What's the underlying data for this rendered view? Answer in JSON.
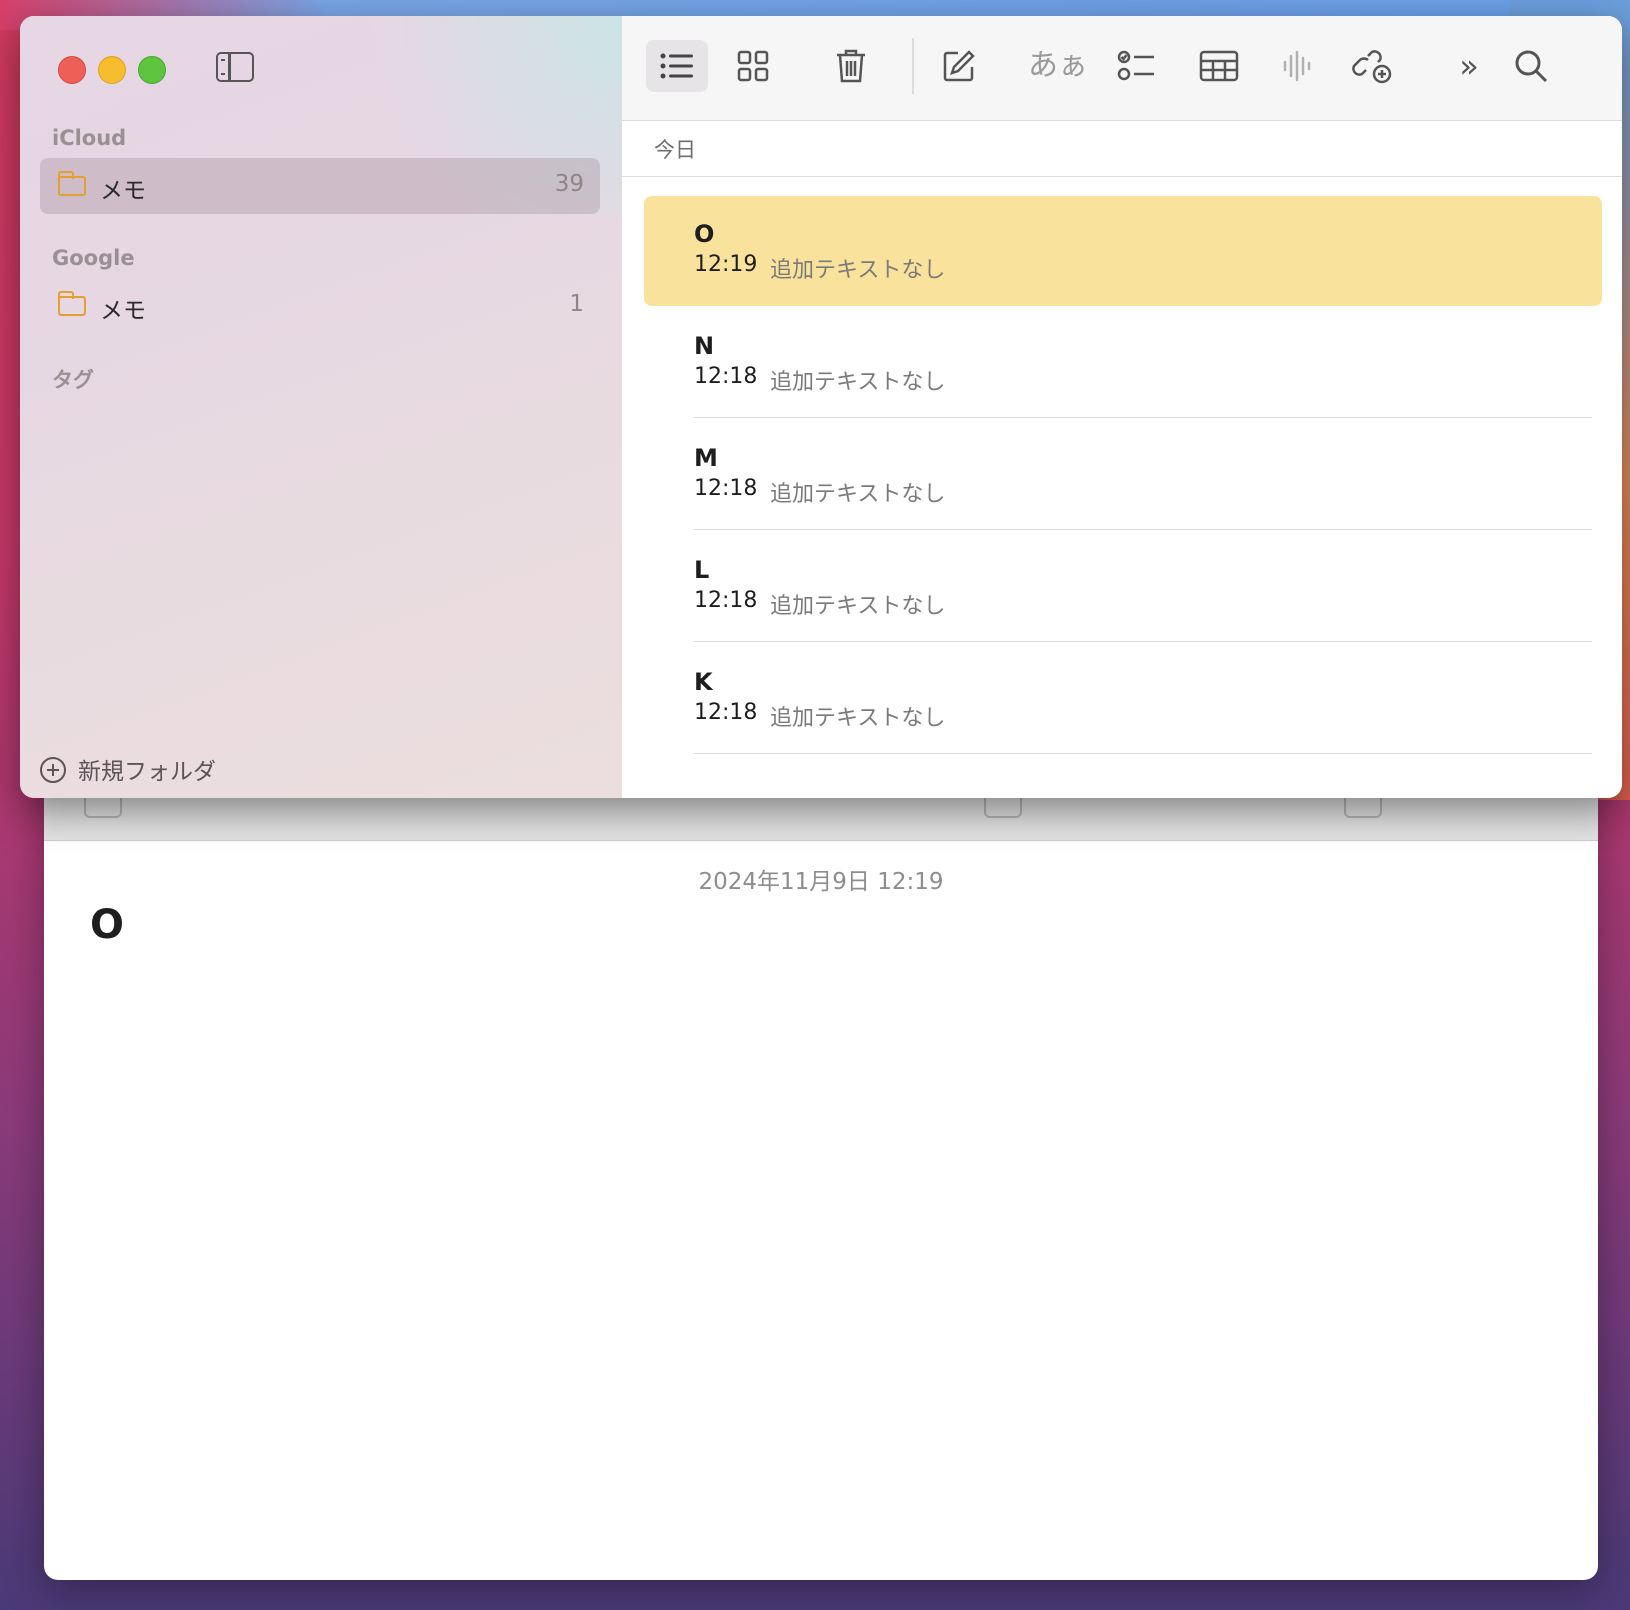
{
  "window": {
    "sidebar": {
      "sections": [
        {
          "label": "iCloud",
          "folders": [
            {
              "name": "メモ",
              "count": "39",
              "selected": true
            }
          ]
        },
        {
          "label": "Google",
          "folders": [
            {
              "name": "メモ",
              "count": "1",
              "selected": false
            }
          ]
        },
        {
          "label": "タグ",
          "folders": []
        }
      ],
      "new_folder_label": "新規フォルダ"
    },
    "toolbar": {
      "font_label": "あぁ",
      "icons": [
        "list-view-icon",
        "gallery-view-icon",
        "trash-icon",
        "compose-icon",
        "format-icon",
        "checklist-icon",
        "table-icon",
        "audio-icon",
        "share-collab-icon",
        "more-icon",
        "search-icon"
      ]
    },
    "list": {
      "section_header": "今日",
      "notes": [
        {
          "title": "O",
          "time": "12:19",
          "preview": "追加テキストなし",
          "selected": true
        },
        {
          "title": "N",
          "time": "12:18",
          "preview": "追加テキストなし",
          "selected": false
        },
        {
          "title": "M",
          "time": "12:18",
          "preview": "追加テキストなし",
          "selected": false
        },
        {
          "title": "L",
          "time": "12:18",
          "preview": "追加テキストなし",
          "selected": false
        },
        {
          "title": "K",
          "time": "12:18",
          "preview": "追加テキストなし",
          "selected": false
        }
      ]
    }
  },
  "editor": {
    "date": "2024年11月9日 12:19",
    "title": "O"
  },
  "colors": {
    "selection_note": "#f9e39c",
    "folder_accent": "#e3a031",
    "close": "#ee5f57",
    "minimize": "#f6be2e",
    "maximize": "#5ec53f"
  }
}
